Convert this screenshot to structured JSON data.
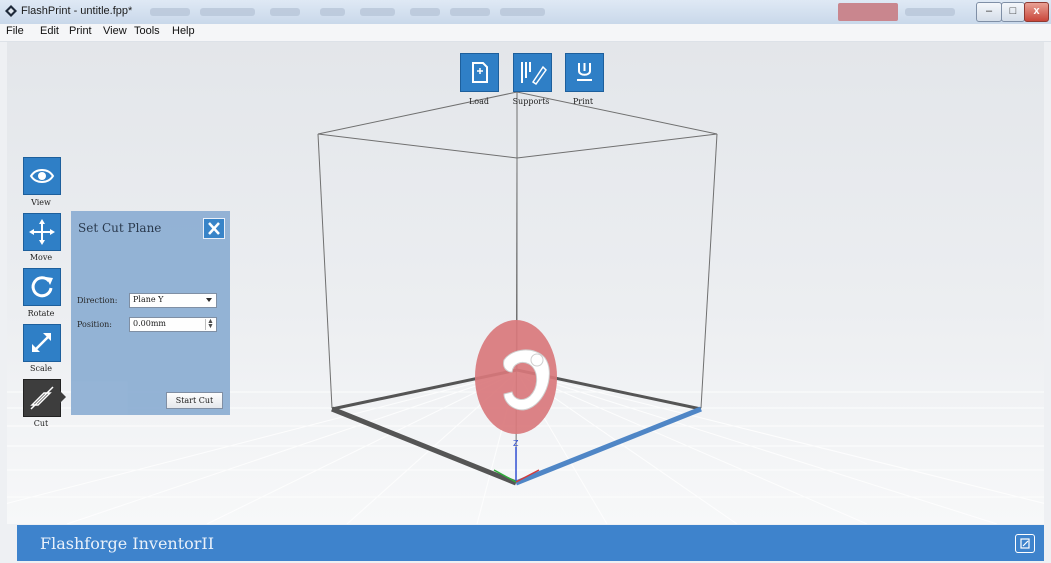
{
  "window": {
    "title": "FlashPrint - untitle.fpp*",
    "minimize": "–",
    "maximize": "□",
    "close": "x"
  },
  "menu": [
    "File",
    "Edit",
    "Print",
    "View",
    "Tools",
    "Help"
  ],
  "top_toolbar": [
    {
      "label": "Load",
      "icon": "load-file-icon"
    },
    {
      "label": "Supports",
      "icon": "supports-icon"
    },
    {
      "label": "Print",
      "icon": "print-icon"
    }
  ],
  "left_toolbar": [
    {
      "label": "View",
      "icon": "eye-icon"
    },
    {
      "label": "Move",
      "icon": "move-arrows-icon"
    },
    {
      "label": "Rotate",
      "icon": "rotate-icon"
    },
    {
      "label": "Scale",
      "icon": "scale-icon"
    },
    {
      "label": "Cut",
      "icon": "cut-icon",
      "active": true
    }
  ],
  "cut_panel": {
    "title": "Set Cut Plane",
    "direction_label": "Direction:",
    "direction_value": "Plane Y",
    "position_label": "Position:",
    "position_value": "0.00mm",
    "start_button": "Start Cut"
  },
  "axis_labels": {
    "z": "Z"
  },
  "status_bar": {
    "brand": "Flashforge InventorII"
  },
  "colors": {
    "accent": "#2f7fc6",
    "bottom_bar": "#3e83cc",
    "cut_plane": "#d9787c",
    "panel": "#8fb0d4"
  }
}
